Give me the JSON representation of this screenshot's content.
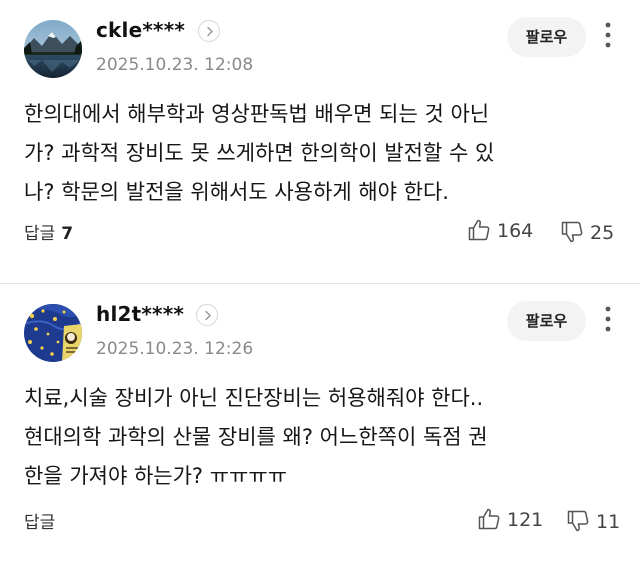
{
  "comments": [
    {
      "username": "ckle****",
      "timestamp": "2025.10.23. 12:08",
      "follow_label": "팔로우",
      "body": "한의대에서 해부학과 영상판독법 배우면 되는 것 아닌\n가? 과학적 장비도 못 쓰게하면 한의학이 발전할 수 있\n나? 학문의 발전을 위해서도 사용하게 해야 한다.",
      "reply_label": "답글",
      "reply_count": "7",
      "likes": "164",
      "dislikes": "25",
      "avatar": "mountain-lake-photo"
    },
    {
      "username": "hl2t****",
      "timestamp": "2025.10.23. 12:26",
      "follow_label": "팔로우",
      "body": "치료,시술 장비가 아닌 진단장비는 허용해줘야 한다..\n현대의학 과학의 산물 장비를 왜? 어느한쪽이 독점 권\n한을 가져야 하는가? ㅠㅠㅠㅠ",
      "reply_label": "답글",
      "reply_count": "",
      "likes": "121",
      "dislikes": "11",
      "avatar": "starry-night-illustration"
    }
  ],
  "colors": {
    "text": "#161616",
    "meta": "#8a8a8a",
    "follow_bg": "#f3f3f3",
    "divider": "#e6e6e6"
  },
  "icons": [
    "chevron-right-icon",
    "more-vertical-icon",
    "thumbs-up-icon",
    "thumbs-down-icon"
  ]
}
